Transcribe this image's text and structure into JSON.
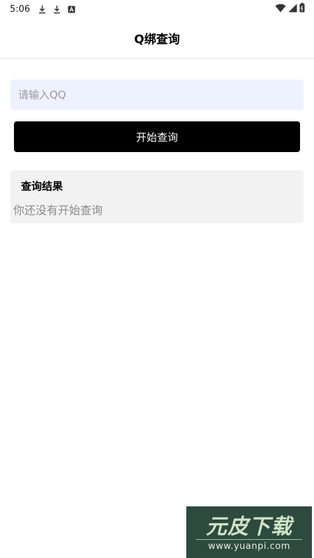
{
  "status_bar": {
    "time": "5:06",
    "left_icons": [
      "download-icon",
      "download-icon",
      "notification-icon"
    ],
    "right_icons": [
      "wifi-icon",
      "signal-icon",
      "battery-icon"
    ]
  },
  "header": {
    "title": "Q绑查询"
  },
  "search": {
    "placeholder": "请输入QQ",
    "value": ""
  },
  "actions": {
    "query_label": "开始查询"
  },
  "result": {
    "title": "查询结果",
    "message": "你还没有开始查询"
  },
  "watermark": {
    "title": "元皮下载",
    "url": "www.yuanpi.com"
  },
  "colors": {
    "input_background": "#eef2ff",
    "button_background": "#000000",
    "card_background": "#f2f2f2",
    "watermark_background": "#2d4a3f"
  }
}
